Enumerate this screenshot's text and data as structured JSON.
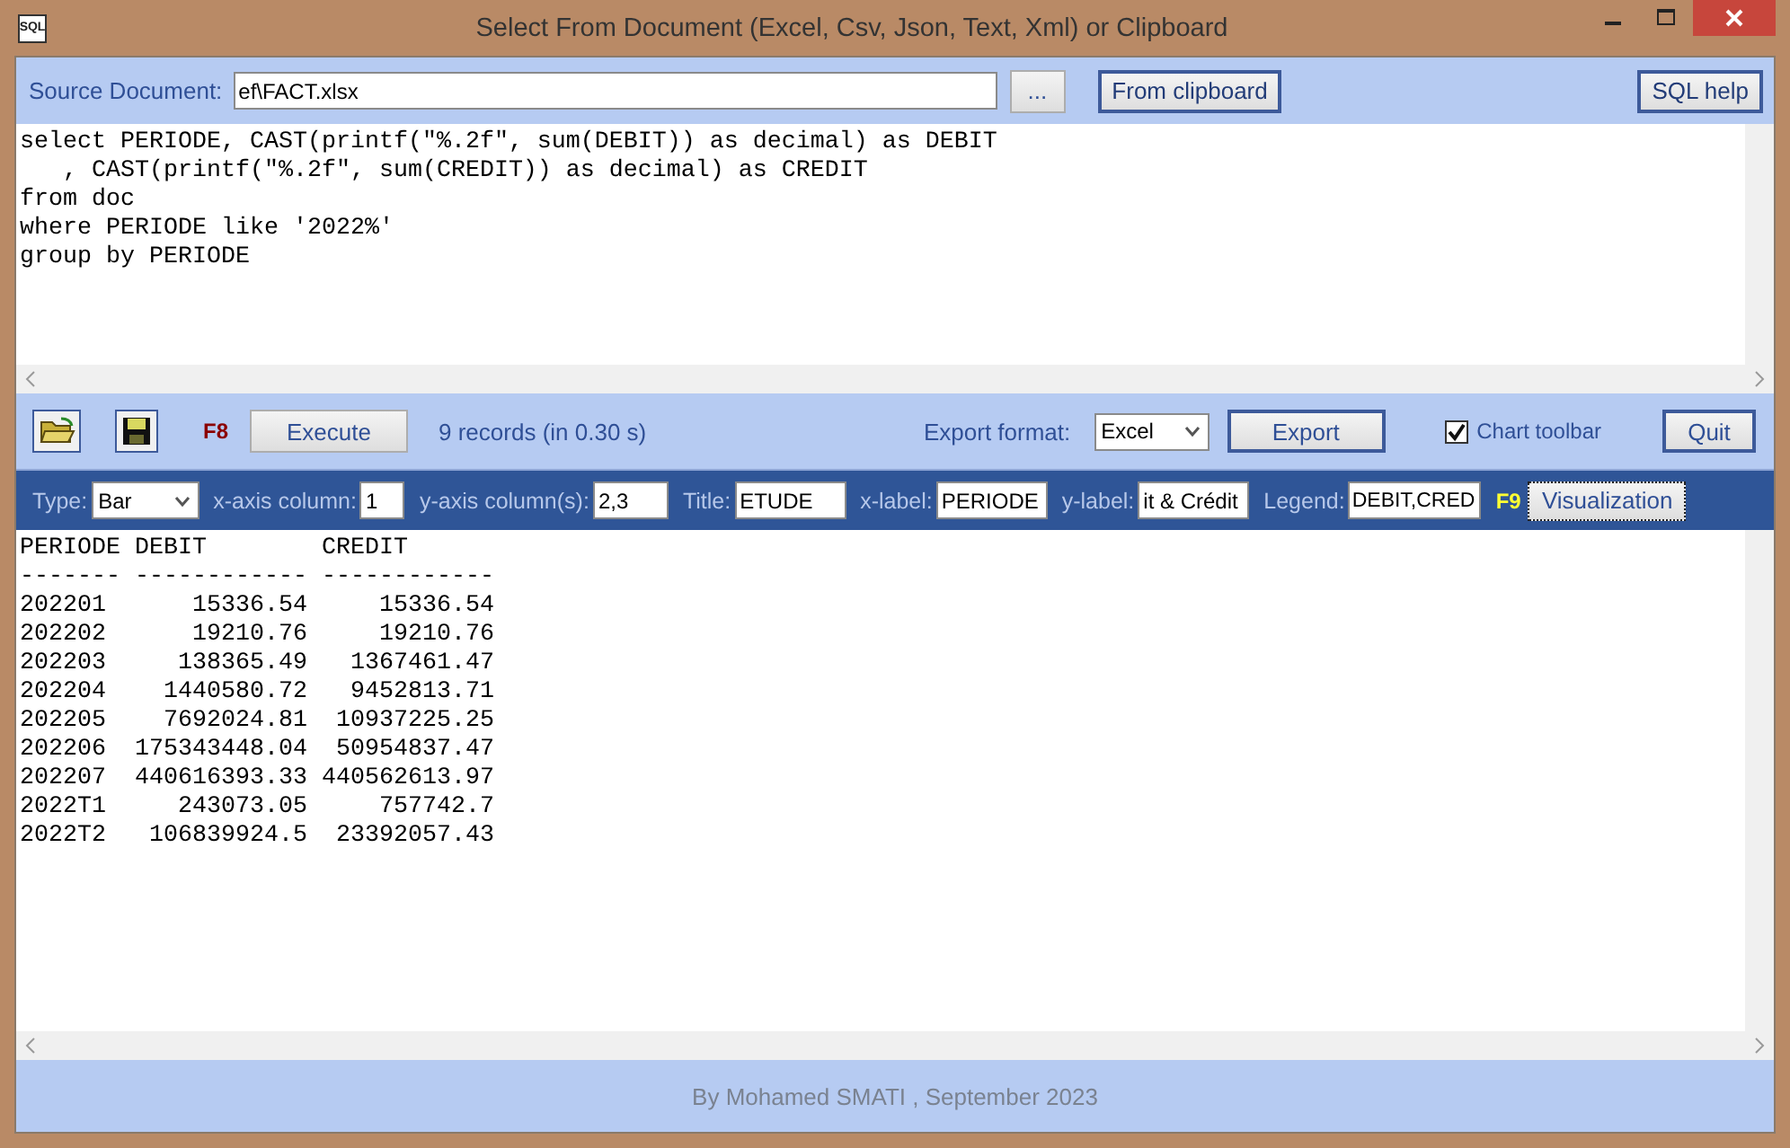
{
  "window": {
    "icon_label": "SQL",
    "title": "Select From Document (Excel, Csv, Json, Text, Xml) or Clipboard"
  },
  "source": {
    "label": "Source Document:",
    "value": "ef\\FACT.xlsx",
    "browse_button": "...",
    "clipboard_button": "From clipboard",
    "help_button": "SQL help"
  },
  "sql_lines": [
    "select PERIODE, CAST(printf(\"%.2f\", sum(DEBIT)) as decimal) as DEBIT",
    "   , CAST(printf(\"%.2f\", sum(CREDIT)) as decimal) as CREDIT",
    "from doc",
    "where PERIODE like '2022%'",
    "group by PERIODE"
  ],
  "toolbar": {
    "execute_key": "F8",
    "execute_button": "Execute",
    "status": "9 records  (in 0.30 s)",
    "export_label": "Export format:",
    "export_format": "Excel",
    "export_button": "Export",
    "chart_toolbar": {
      "label": "Chart toolbar",
      "checked": true
    },
    "quit_button": "Quit"
  },
  "chart_bar": {
    "fields": [
      {
        "kind": "dropdown",
        "label": "Type:",
        "value": "Bar"
      },
      {
        "kind": "input",
        "label": "x-axis column:",
        "value": "1"
      },
      {
        "kind": "input",
        "label": "y-axis column(s):",
        "value": "2,3"
      },
      {
        "kind": "input",
        "label": "Title:",
        "value": "ETUDE"
      },
      {
        "kind": "input",
        "label": "x-label:",
        "value": "PERIODE"
      },
      {
        "kind": "input",
        "label": "y-label:",
        "value": "it & Crédit"
      },
      {
        "kind": "input",
        "label": "Legend:",
        "value": "DEBIT,CRED"
      }
    ],
    "visualize_key": "F9",
    "visualize_button": "Visualization"
  },
  "result_lines": [
    "PERIODE DEBIT        CREDIT",
    "------- ------------ ------------",
    "202201      15336.54     15336.54",
    "202202      19210.76     19210.76",
    "202203     138365.49   1367461.47",
    "202204    1440580.72   9452813.71",
    "202205    7692024.81  10937225.25",
    "202206  175343448.04  50954837.47",
    "202207  440616393.33 440562613.97",
    "2022T1     243073.05     757742.7",
    "2022T2   106839924.5  23392057.43"
  ],
  "footer": "By Mohamed SMATI , September 2023"
}
